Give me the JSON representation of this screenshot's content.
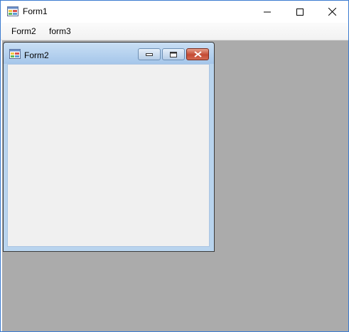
{
  "main_window": {
    "title": "Form1",
    "icon": "winforms-app-icon",
    "controls": {
      "minimize": "minimize-icon",
      "maximize": "maximize-icon",
      "close": "close-icon"
    }
  },
  "menu": {
    "items": [
      {
        "label": "Form2"
      },
      {
        "label": "form3"
      }
    ]
  },
  "child_window": {
    "title": "Form2",
    "icon": "winforms-app-icon",
    "controls": {
      "minimize": "minimize-icon",
      "restore": "restore-icon",
      "close": "close-icon"
    }
  },
  "colors": {
    "mdi_background": "#ababab",
    "window_border": "#3b7bd0",
    "child_client": "#f0f0f0"
  }
}
